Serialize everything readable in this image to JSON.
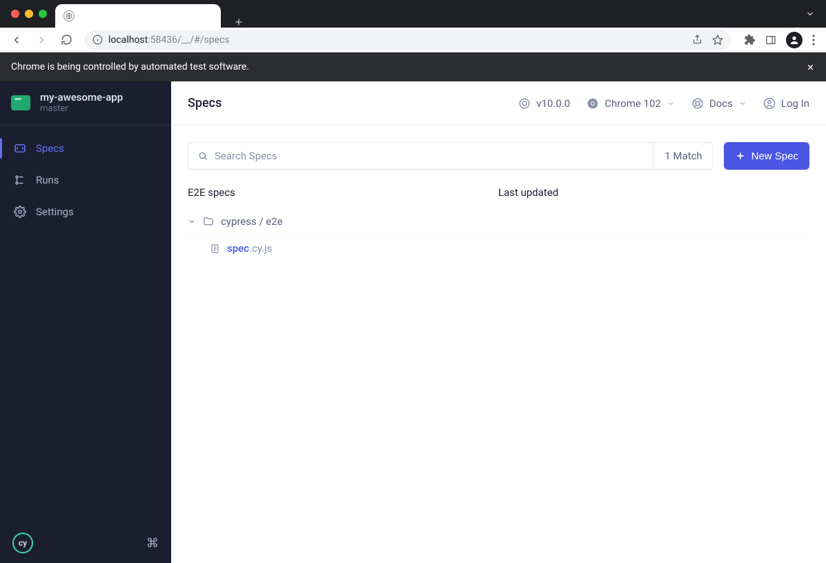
{
  "browser": {
    "url_host": "localhost",
    "url_port": ":58436",
    "url_path": "/__/#/specs"
  },
  "infobar": {
    "message": "Chrome is being controlled by automated test software."
  },
  "sidebar": {
    "project_name": "my-awesome-app",
    "branch": "master",
    "items": [
      {
        "label": "Specs"
      },
      {
        "label": "Runs"
      },
      {
        "label": "Settings"
      }
    ],
    "logo_text": "cy"
  },
  "topbar": {
    "title": "Specs",
    "version": "v10.0.0",
    "browser": "Chrome 102",
    "docs": "Docs",
    "login": "Log In"
  },
  "search": {
    "placeholder": "Search Specs",
    "match_count": "1 Match"
  },
  "buttons": {
    "new_spec": "New Spec"
  },
  "columns": {
    "specs": "E2E specs",
    "updated": "Last updated"
  },
  "tree": {
    "folder": "cypress / e2e",
    "file_name": "spec",
    "file_ext": ".cy.js"
  }
}
